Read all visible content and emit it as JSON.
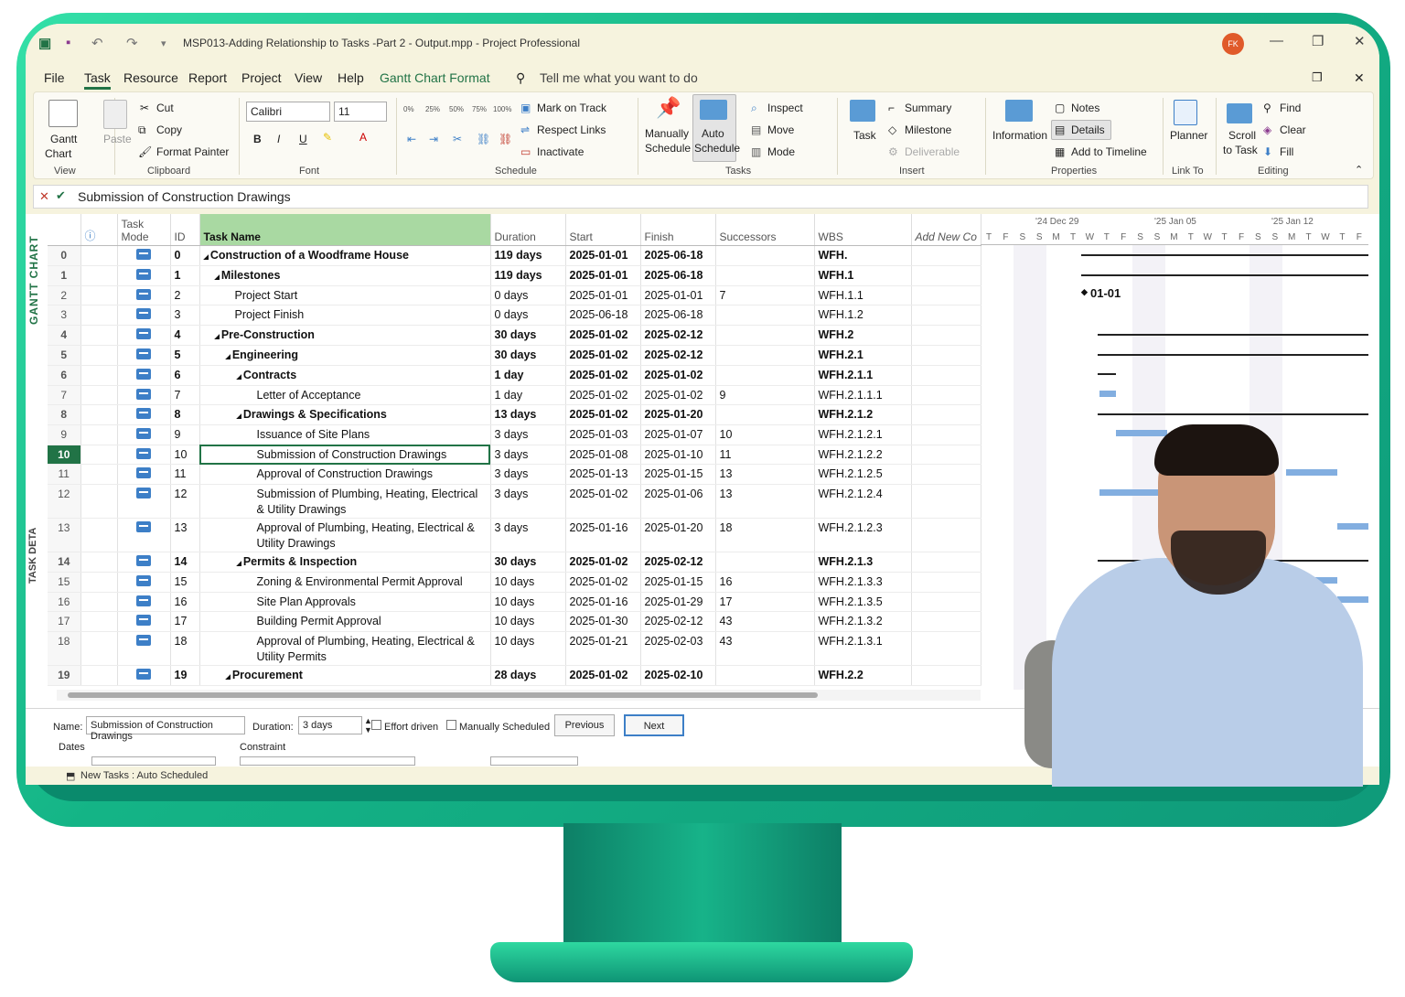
{
  "window": {
    "title": "MSP013-Adding Relationship to Tasks -Part 2 - Output.mpp  -  Project Professional",
    "avatar": "FK"
  },
  "menu": {
    "items": [
      "File",
      "Task",
      "Resource",
      "Report",
      "Project",
      "View",
      "Help",
      "Gantt Chart Format"
    ],
    "search_placeholder": "Tell me what you want to do"
  },
  "ribbon": {
    "view": {
      "gantt": "Gantt",
      "chart": "Chart",
      "label": "View"
    },
    "clipboard": {
      "paste": "Paste",
      "cut": "Cut",
      "copy": "Copy",
      "format_painter": "Format Painter",
      "label": "Clipboard"
    },
    "font": {
      "family": "Calibri",
      "size": "11",
      "bold": "B",
      "italic": "I",
      "underline": "U",
      "label": "Font"
    },
    "schedule": {
      "mark_on_track": "Mark on Track",
      "respect_links": "Respect Links",
      "inactivate": "Inactivate",
      "label": "Schedule",
      "pct": [
        "0%",
        "25%",
        "50%",
        "75%",
        "100%"
      ]
    },
    "tasks": {
      "manually": "Manually",
      "schedule1": "Schedule",
      "auto": "Auto",
      "schedule2": "Schedule",
      "inspect": "Inspect",
      "move": "Move",
      "mode": "Mode",
      "label": "Tasks"
    },
    "insert": {
      "task": "Task",
      "summary": "Summary",
      "milestone": "Milestone",
      "deliverable": "Deliverable",
      "label": "Insert"
    },
    "properties": {
      "information": "Information",
      "notes": "Notes",
      "details": "Details",
      "add_timeline": "Add to Timeline",
      "label": "Properties"
    },
    "link_to": {
      "planner": "Planner",
      "label": "Link To"
    },
    "editing": {
      "scroll": "Scroll",
      "to_task": "to Task",
      "find": "Find",
      "clear": "Clear",
      "fill": "Fill",
      "label": "Editing"
    }
  },
  "formula_bar": {
    "text": "Submission of Construction Drawings"
  },
  "side_labels": {
    "gantt": "GANTT CHART",
    "details": "TASK DETA"
  },
  "columns": {
    "mode1": "Task",
    "mode2": "Mode",
    "id": "ID",
    "name": "Task Name",
    "duration": "Duration",
    "start": "Start",
    "finish": "Finish",
    "successors": "Successors",
    "wbs": "WBS",
    "add_new": "Add New Co"
  },
  "rows": [
    {
      "row": "0",
      "id": "0",
      "name": "Construction of a Woodframe House",
      "indent": 0,
      "summary": true,
      "duration": "119 days",
      "start": "2025-01-01",
      "finish": "2025-06-18",
      "successors": "",
      "wbs": "WFH."
    },
    {
      "row": "1",
      "id": "1",
      "name": "Milestones",
      "indent": 1,
      "summary": true,
      "duration": "119 days",
      "start": "2025-01-01",
      "finish": "2025-06-18",
      "successors": "",
      "wbs": "WFH.1"
    },
    {
      "row": "2",
      "id": "2",
      "name": "Project Start",
      "indent": 2,
      "summary": false,
      "duration": "0 days",
      "start": "2025-01-01",
      "finish": "2025-01-01",
      "successors": "7",
      "wbs": "WFH.1.1"
    },
    {
      "row": "3",
      "id": "3",
      "name": "Project Finish",
      "indent": 2,
      "summary": false,
      "duration": "0 days",
      "start": "2025-06-18",
      "finish": "2025-06-18",
      "successors": "",
      "wbs": "WFH.1.2"
    },
    {
      "row": "4",
      "id": "4",
      "name": "Pre-Construction",
      "indent": 1,
      "summary": true,
      "duration": "30 days",
      "start": "2025-01-02",
      "finish": "2025-02-12",
      "successors": "",
      "wbs": "WFH.2"
    },
    {
      "row": "5",
      "id": "5",
      "name": "Engineering",
      "indent": 2,
      "summary": true,
      "duration": "30 days",
      "start": "2025-01-02",
      "finish": "2025-02-12",
      "successors": "",
      "wbs": "WFH.2.1"
    },
    {
      "row": "6",
      "id": "6",
      "name": "Contracts",
      "indent": 3,
      "summary": true,
      "duration": "1 day",
      "start": "2025-01-02",
      "finish": "2025-01-02",
      "successors": "",
      "wbs": "WFH.2.1.1"
    },
    {
      "row": "7",
      "id": "7",
      "name": "Letter of Acceptance",
      "indent": 4,
      "summary": false,
      "duration": "1 day",
      "start": "2025-01-02",
      "finish": "2025-01-02",
      "successors": "9",
      "wbs": "WFH.2.1.1.1"
    },
    {
      "row": "8",
      "id": "8",
      "name": "Drawings & Specifications",
      "indent": 3,
      "summary": true,
      "duration": "13 days",
      "start": "2025-01-02",
      "finish": "2025-01-20",
      "successors": "",
      "wbs": "WFH.2.1.2"
    },
    {
      "row": "9",
      "id": "9",
      "name": "Issuance of Site Plans",
      "indent": 4,
      "summary": false,
      "duration": "3 days",
      "start": "2025-01-03",
      "finish": "2025-01-07",
      "successors": "10",
      "wbs": "WFH.2.1.2.1"
    },
    {
      "row": "10",
      "id": "10",
      "name": "Submission of Construction Drawings",
      "indent": 4,
      "summary": false,
      "duration": "3 days",
      "start": "2025-01-08",
      "finish": "2025-01-10",
      "successors": "11",
      "wbs": "WFH.2.1.2.2",
      "selected": true
    },
    {
      "row": "11",
      "id": "11",
      "name": "Approval of Construction Drawings",
      "indent": 4,
      "summary": false,
      "duration": "3 days",
      "start": "2025-01-13",
      "finish": "2025-01-15",
      "successors": "13",
      "wbs": "WFH.2.1.2.5"
    },
    {
      "row": "12",
      "id": "12",
      "name": "Submission of Plumbing, Heating, Electrical & Utility Drawings",
      "indent": 4,
      "summary": false,
      "duration": "3 days",
      "start": "2025-01-02",
      "finish": "2025-01-06",
      "successors": "13",
      "wbs": "WFH.2.1.2.4",
      "tall": true
    },
    {
      "row": "13",
      "id": "13",
      "name": "Approval of Plumbing, Heating, Electrical & Utility Drawings",
      "indent": 4,
      "summary": false,
      "duration": "3 days",
      "start": "2025-01-16",
      "finish": "2025-01-20",
      "successors": "18",
      "wbs": "WFH.2.1.2.3",
      "tall": true
    },
    {
      "row": "14",
      "id": "14",
      "name": "Permits & Inspection",
      "indent": 3,
      "summary": true,
      "duration": "30 days",
      "start": "2025-01-02",
      "finish": "2025-02-12",
      "successors": "",
      "wbs": "WFH.2.1.3"
    },
    {
      "row": "15",
      "id": "15",
      "name": "Zoning & Environmental Permit Approval",
      "indent": 4,
      "summary": false,
      "duration": "10 days",
      "start": "2025-01-02",
      "finish": "2025-01-15",
      "successors": "16",
      "wbs": "WFH.2.1.3.3"
    },
    {
      "row": "16",
      "id": "16",
      "name": "Site Plan Approvals",
      "indent": 4,
      "summary": false,
      "duration": "10 days",
      "start": "2025-01-16",
      "finish": "2025-01-29",
      "successors": "17",
      "wbs": "WFH.2.1.3.5"
    },
    {
      "row": "17",
      "id": "17",
      "name": "Building Permit Approval",
      "indent": 4,
      "summary": false,
      "duration": "10 days",
      "start": "2025-01-30",
      "finish": "2025-02-12",
      "successors": "43",
      "wbs": "WFH.2.1.3.2"
    },
    {
      "row": "18",
      "id": "18",
      "name": "Approval of Plumbing, Heating, Electrical & Utility Permits",
      "indent": 4,
      "summary": false,
      "duration": "10 days",
      "start": "2025-01-21",
      "finish": "2025-02-03",
      "successors": "43",
      "wbs": "WFH.2.1.3.1",
      "tall": true
    },
    {
      "row": "19",
      "id": "19",
      "name": "Procurement",
      "indent": 2,
      "summary": true,
      "duration": "28 days",
      "start": "2025-01-02",
      "finish": "2025-02-10",
      "successors": "",
      "wbs": "WFH.2.2"
    }
  ],
  "gantt": {
    "weeks": [
      "'24 Dec 29",
      "'25 Jan 05",
      "'25 Jan 12"
    ],
    "days": [
      "T",
      "F",
      "S",
      "S",
      "M",
      "T",
      "W",
      "T",
      "F",
      "S",
      "S",
      "M",
      "T",
      "W",
      "T",
      "F",
      "S",
      "S",
      "M",
      "T",
      "W",
      "T",
      "F"
    ],
    "milestone_label": "01-01"
  },
  "task_details": {
    "name_label": "Name:",
    "name_value": "Submission of Construction Drawings",
    "duration_label": "Duration:",
    "duration_value": "3 days",
    "effort_driven": "Effort driven",
    "manually_scheduled": "Manually Scheduled",
    "previous": "Previous",
    "next": "Next",
    "dates": "Dates",
    "constraint": "Constraint"
  },
  "status_bar": {
    "text": "New Tasks : Auto Scheduled"
  }
}
